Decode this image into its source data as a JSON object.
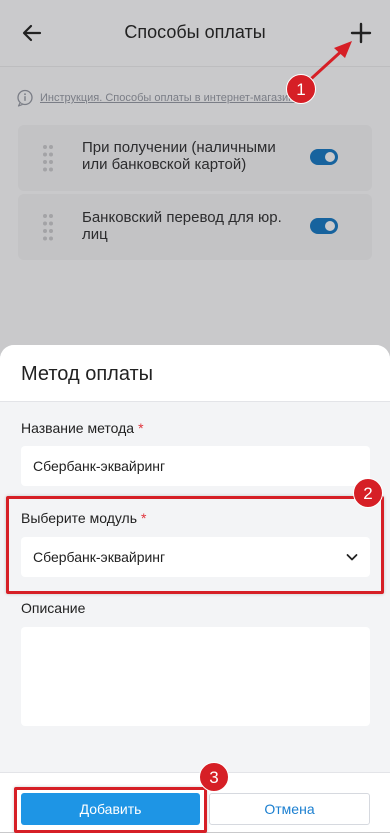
{
  "header": {
    "title": "Способы оплаты",
    "back_icon": "arrow-left-icon",
    "add_icon": "plus-icon"
  },
  "help": {
    "link_text": "Инструкция. Способы оплаты в интернет-магазине"
  },
  "payment_methods": [
    {
      "label": "При получении (наличными или банковской картой)",
      "enabled": true
    },
    {
      "label": "Банковский перевод для юр. лиц",
      "enabled": true
    }
  ],
  "sheet": {
    "title": "Метод оплаты",
    "method_name": {
      "label": "Название метода",
      "required_mark": "*",
      "value": "Сбербанк-эквайринг"
    },
    "module": {
      "label": "Выберите модуль",
      "required_mark": "*",
      "selected": "Сбербанк-эквайринг"
    },
    "description": {
      "label": "Описание",
      "value": ""
    },
    "add_button": "Добавить",
    "cancel_button": "Отмена"
  },
  "annotations": [
    "1",
    "2",
    "3"
  ],
  "colors": {
    "accent": "#1e95e5",
    "annotation": "#d61f26",
    "required": "#e0343c",
    "toggle_on": "#17639e"
  }
}
